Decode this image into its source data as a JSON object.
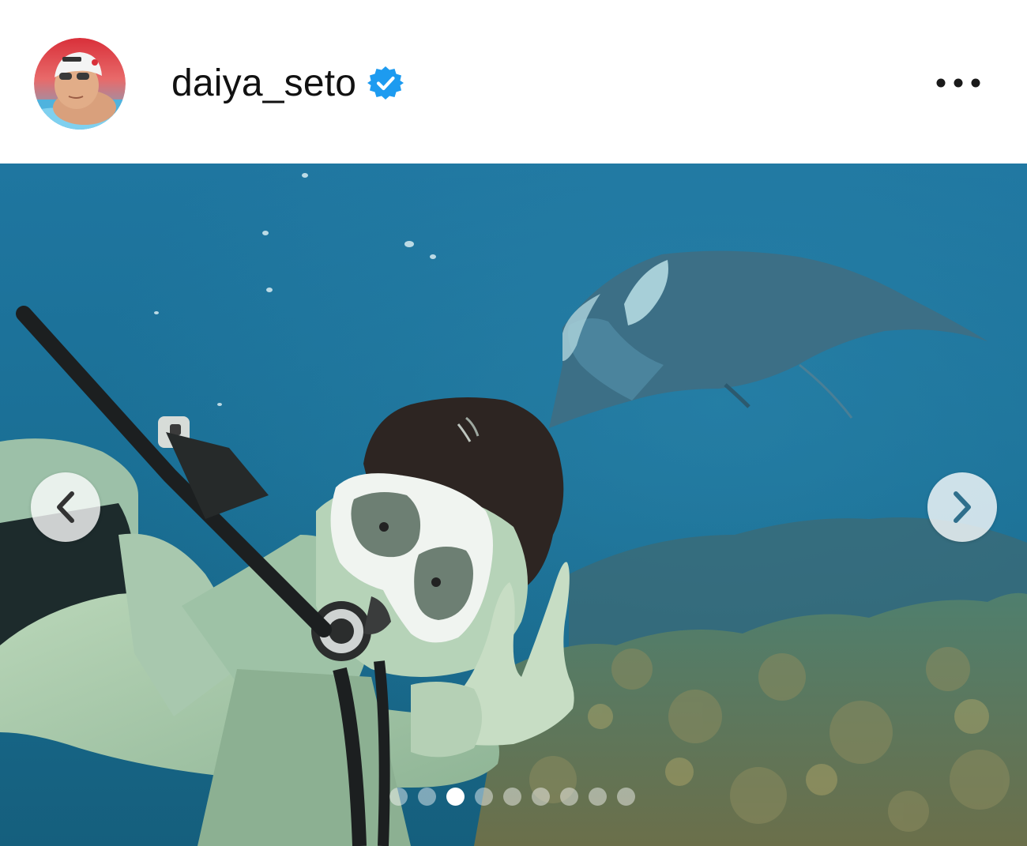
{
  "profile": {
    "username": "daiya_seto",
    "verified": true,
    "avatar_icon": "swimmer-avatar"
  },
  "header": {
    "more_icon": "more-options-icon"
  },
  "carousel": {
    "prev_icon": "chevron-left-icon",
    "next_icon": "chevron-right-icon",
    "total_slides": 9,
    "active_slide": 3
  },
  "colors": {
    "verified_blue": "#1d9bf0",
    "ocean": "#1b6f95"
  }
}
